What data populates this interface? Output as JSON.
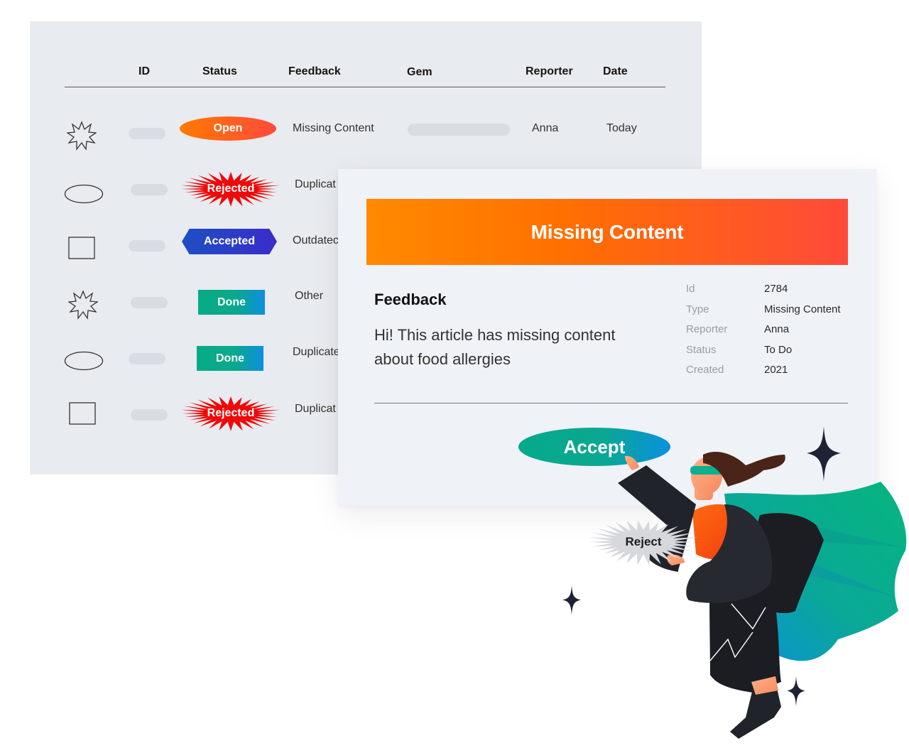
{
  "table": {
    "columns": {
      "id": "ID",
      "status": "Status",
      "feedback": "Feedback",
      "gem": "Gem",
      "reporter": "Reporter",
      "date": "Date"
    },
    "rows": [
      {
        "shape": "starburst",
        "status": "Open",
        "feedback": "Missing Content",
        "reporter": "Anna",
        "date": "Today"
      },
      {
        "shape": "ellipse",
        "status": "Rejected",
        "feedback": "Duplicat"
      },
      {
        "shape": "rectangle",
        "status": "Accepted",
        "feedback": "Outdatec"
      },
      {
        "shape": "starburst",
        "status": "Done",
        "feedback": "Other"
      },
      {
        "shape": "ellipse",
        "status": "Done",
        "feedback": "Duplicate"
      },
      {
        "shape": "rectangle",
        "status": "Rejected",
        "feedback": "Duplicat"
      }
    ]
  },
  "detail": {
    "title": "Missing Content",
    "feedback_heading": "Feedback",
    "feedback_body": "Hi! This article has missing content about food allergies",
    "meta": [
      {
        "label": "Id",
        "value": "2784"
      },
      {
        "label": "Type",
        "value": "Missing Content"
      },
      {
        "label": "Reporter",
        "value": "Anna"
      },
      {
        "label": "Status",
        "value": "To Do"
      },
      {
        "label": "Created",
        "value": "2021"
      }
    ],
    "accept_label": "Accept",
    "reject_label": "Reject"
  },
  "colors": {
    "open": "#ff7a00",
    "rejected": "#ee0a0a",
    "accepted": "#2a3fc6",
    "done": "#06ab85",
    "header_gradient_start": "#ff8a00",
    "header_gradient_end": "#ff4a3a"
  },
  "icons": [
    "starburst-icon",
    "ellipse-icon",
    "rectangle-icon",
    "sparkle-icon",
    "superhero-illustration"
  ]
}
